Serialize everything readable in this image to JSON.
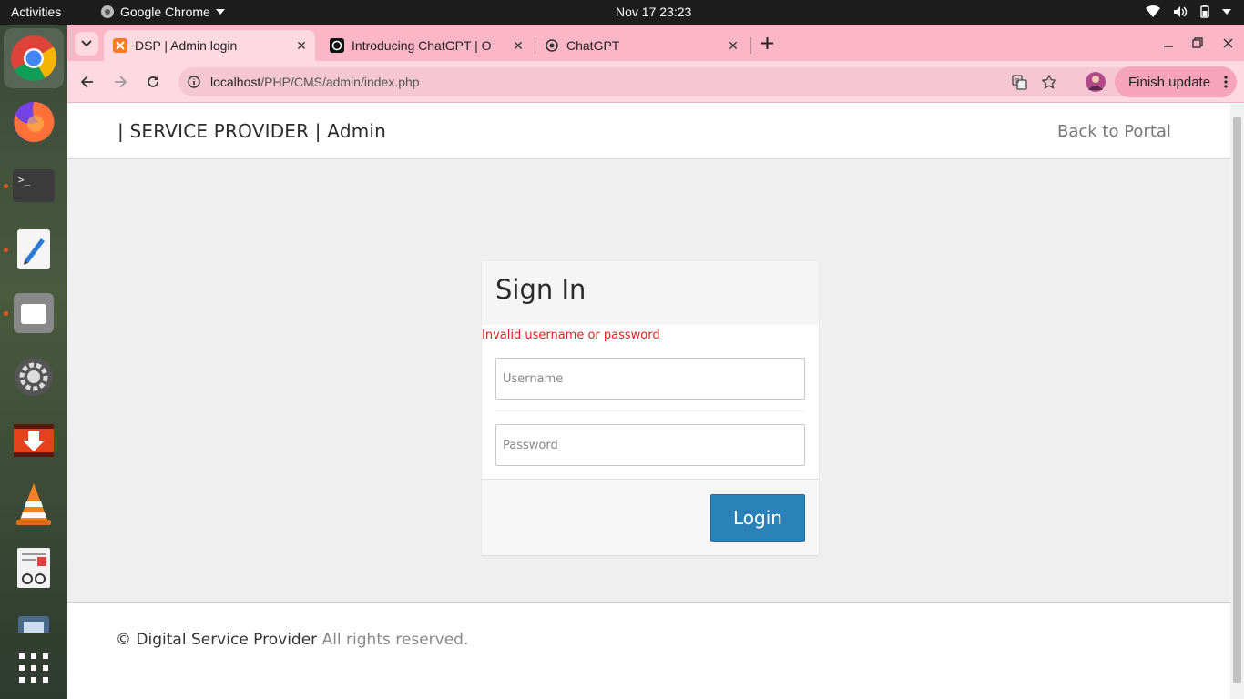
{
  "topbar": {
    "activities": "Activities",
    "app_name": "Google Chrome",
    "clock": "Nov 17  23:23"
  },
  "dock": {
    "items": [
      "chrome-icon",
      "firefox-icon",
      "terminal-icon",
      "text-editor-icon",
      "files-icon",
      "settings-icon",
      "downloader-icon",
      "vlc-icon",
      "document-viewer-icon",
      "screenshot-icon",
      "app-grid-icon"
    ]
  },
  "browser": {
    "tabs": [
      {
        "title": "DSP | Admin login",
        "active": true
      },
      {
        "title": "Introducing ChatGPT | O",
        "active": false
      },
      {
        "title": "ChatGPT",
        "active": false
      }
    ],
    "url_host": "localhost",
    "url_path": "/PHP/CMS/admin/index.php",
    "finish_update": "Finish update"
  },
  "page": {
    "brand": "| SERVICE PROVIDER | Admin",
    "back_link": "Back to Portal",
    "signin_title": "Sign In",
    "error": "Invalid username or password",
    "username_placeholder": "Username",
    "password_placeholder": "Password",
    "login_label": "Login",
    "footer_copy": "©",
    "footer_org": "Digital Service Provider",
    "footer_rest": "All rights reserved."
  },
  "colors": {
    "tabstrip": "#fbb6c8",
    "toolbar": "#ffd9e2",
    "login_button": "#2b82b8",
    "error": "#e02020"
  }
}
